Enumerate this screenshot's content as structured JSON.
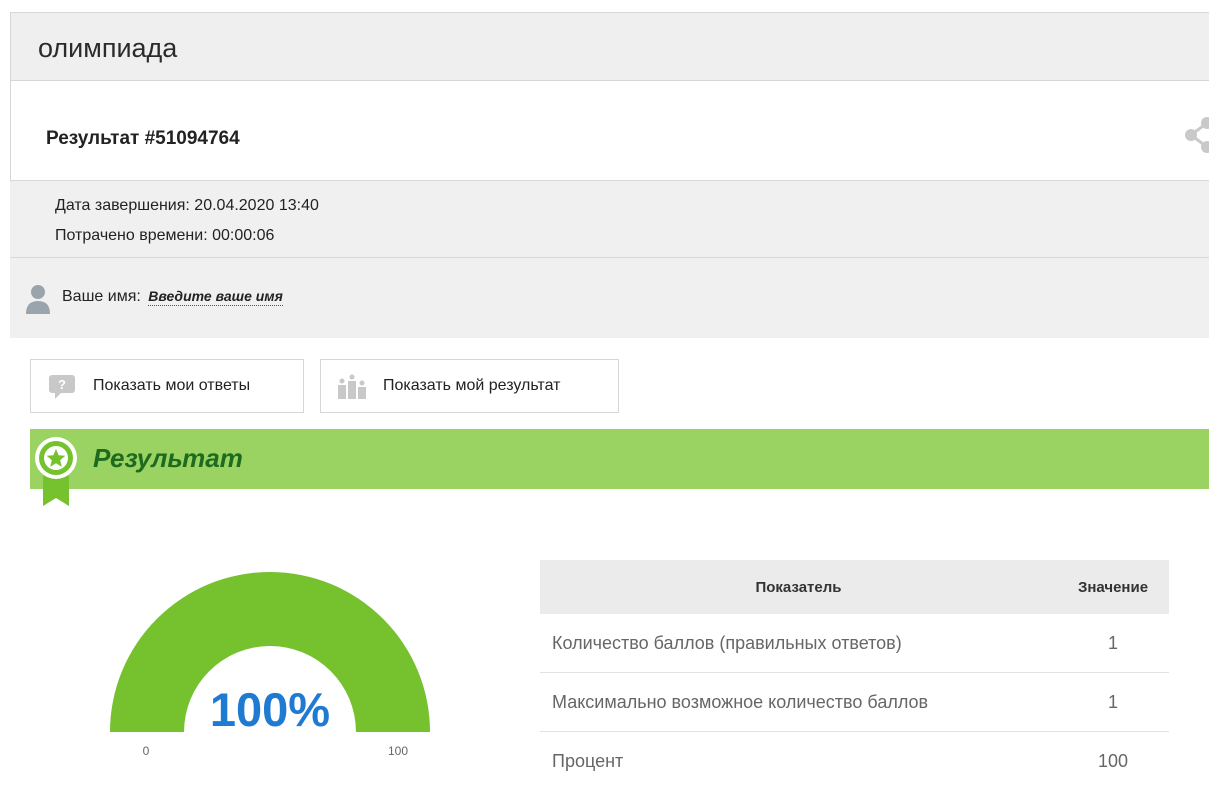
{
  "header": {
    "title": "олимпиада"
  },
  "result": {
    "title": "Результат #51094764"
  },
  "meta": {
    "finish_label": "Дата завершения: ",
    "finish_value": "20.04.2020 13:40",
    "spent_label": "Потрачено времени: ",
    "spent_value": "00:00:06"
  },
  "name": {
    "label": "Ваше имя:",
    "placeholder": "Введите ваше имя"
  },
  "buttons": {
    "show_answers": "Показать мои ответы",
    "show_result": "Показать мой результат"
  },
  "section": {
    "title": "Результат"
  },
  "gauge": {
    "percent_label": "100%",
    "min": "0",
    "max": "100",
    "value": 100,
    "color": "#76c12e",
    "text_color": "#1f7ad1"
  },
  "table": {
    "headers": [
      "Показатель",
      "Значение"
    ],
    "rows": [
      [
        "Количество баллов (правильных ответов)",
        "1"
      ],
      [
        "Максимально возможное количество баллов",
        "1"
      ],
      [
        "Процент",
        "100"
      ]
    ]
  },
  "colors": {
    "band": "#9bd363",
    "band_text": "#1e6a1e",
    "panel": "#f0f0f0"
  }
}
